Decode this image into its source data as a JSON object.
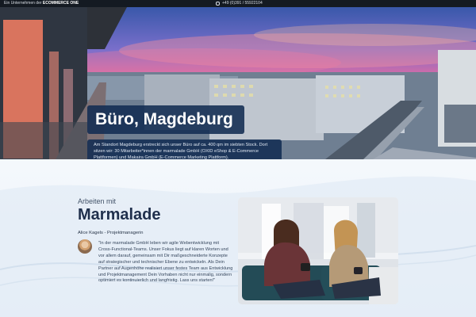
{
  "topbar": {
    "company_prefix": "Ein Unternehmen der",
    "company_name": "ECOMMERCE ONE",
    "phone": "+49 (0)391 / 55922104",
    "phone_icon": "phone-icon"
  },
  "hero": {
    "title": "Büro, Magdeburg",
    "description": "Am Standort Magdeburg erstreckt sich unser Büro auf ca. 400 qm im siebten Stock. Dort sitzen wir: 30 Mitarbeiter*innen der marmalade GmbH (OXID eShop & E-Commerce Plattformen) und Makaira GmbH (E-Commerce Marketing Plattform)."
  },
  "about": {
    "kicker": "Arbeiten mit",
    "heading": "Marmalade",
    "author": "Alice Kagels - Projektmanagerin",
    "quote": "\"In der marmalade GmbH leben wir agile Webentwicklung mit Cross-Functional-Teams. Unser Fokus liegt auf klaren Worten und vor allem darauf, gemeinsam mit Dir maßgeschneiderte Konzepte auf strategischer und technischer Ebene zu entwickeln. Als Dein Partner auf Augenhöhe realisiert unser festes Team aus Entwicklung und Projektmanagement Dein Vorhaben nicht nur einmalig, sondern optimiert es kontinuierlich und langfristig. Lass uns starten!\""
  },
  "colors": {
    "topbar": "#141a22",
    "navy_box": "#122c52",
    "heading": "#1f2f4c",
    "background": "#eef3f8"
  }
}
